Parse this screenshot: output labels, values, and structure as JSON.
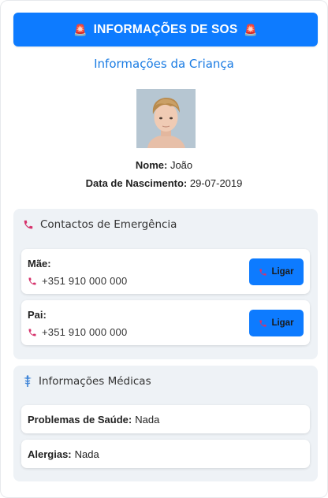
{
  "header": {
    "title": "INFORMAÇÕES DE SOS",
    "siren_glyph": "🚨"
  },
  "child": {
    "section_title": "Informações da Criança",
    "name_label": "Nome:",
    "name_value": "João",
    "dob_label": "Data de Nascimento:",
    "dob_value": "29-07-2019"
  },
  "emergency": {
    "title": "Contactos de Emergência",
    "contacts": [
      {
        "name": "Mãe:",
        "phone": "+351 910 000 000",
        "call_label": "Ligar"
      },
      {
        "name": "Pai:",
        "phone": "+351 910 000 000",
        "call_label": "Ligar"
      }
    ]
  },
  "medical": {
    "title": "Informações Médicas",
    "health_label": "Problemas de Saúde:",
    "health_value": "Nada",
    "allergies_label": "Alergias:",
    "allergies_value": "Nada"
  },
  "colors": {
    "primary": "#0d7bff",
    "link": "#1b7ce3",
    "phone_icon": "#d6336c",
    "card_bg": "#eef2f6"
  }
}
